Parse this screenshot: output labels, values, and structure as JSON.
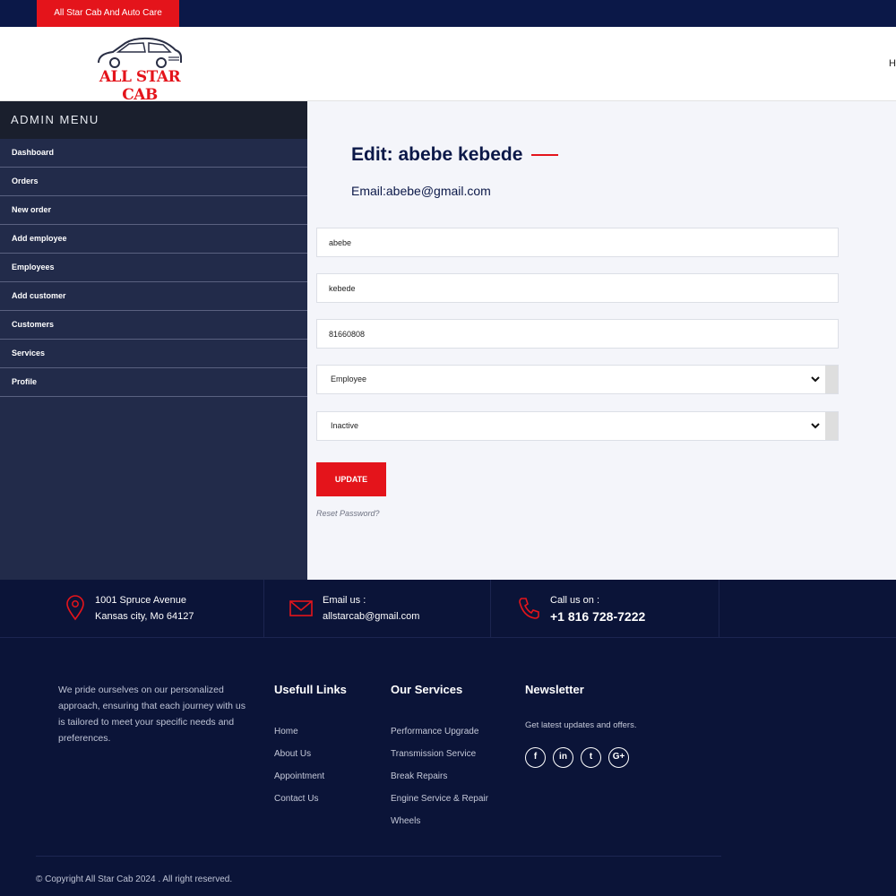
{
  "topbar": {
    "badge": "All Star Cab And Auto Care"
  },
  "header": {
    "logo_text": "ALL STAR CAB",
    "nav_stub": "H"
  },
  "sidebar": {
    "title": "ADMIN MENU",
    "items": [
      {
        "label": "Dashboard"
      },
      {
        "label": "Orders"
      },
      {
        "label": "New order"
      },
      {
        "label": "Add employee"
      },
      {
        "label": "Employees"
      },
      {
        "label": "Add customer"
      },
      {
        "label": "Customers"
      },
      {
        "label": "Services"
      },
      {
        "label": "Profile"
      }
    ]
  },
  "form": {
    "title": "Edit: abebe kebede",
    "email": "Email:abebe@gmail.com",
    "first_name": "abebe",
    "last_name": "kebede",
    "phone": "81660808",
    "role_selected": "Employee",
    "status_selected": "Inactive",
    "update_label": "UPDATE",
    "reset_label": "Reset Password?"
  },
  "footer": {
    "address_line1": "1001 Spruce Avenue",
    "address_line2": "Kansas city, Mo 64127",
    "email_label": "Email us :",
    "email_value": "allstarcab@gmail.com",
    "phone_label": "Call us on :",
    "phone_value": "+1 816 728-7222",
    "about": "We pride ourselves on our personalized approach, ensuring that each journey with us is tailored to meet your specific needs and preferences.",
    "links_title": "Usefull Links",
    "links": [
      "Home",
      "About Us",
      "Appointment",
      "Contact Us"
    ],
    "services_title": "Our Services",
    "services": [
      "Performance Upgrade",
      "Transmission Service",
      "Break Repairs",
      "Engine Service & Repair",
      "Wheels"
    ],
    "newsletter_title": "Newsletter",
    "newsletter_text": "Get latest updates and offers.",
    "socials": [
      {
        "icon": "facebook-icon",
        "glyph": "f"
      },
      {
        "icon": "linkedin-icon",
        "glyph": "in"
      },
      {
        "icon": "twitter-icon",
        "glyph": "t"
      },
      {
        "icon": "google-plus-icon",
        "glyph": "G+"
      }
    ],
    "copyright": "© Copyright All Star Cab 2024 . All right reserved."
  },
  "colors": {
    "brand_red": "#e4141b",
    "navy": "#0b1848",
    "sidebar": "#222b4a"
  }
}
